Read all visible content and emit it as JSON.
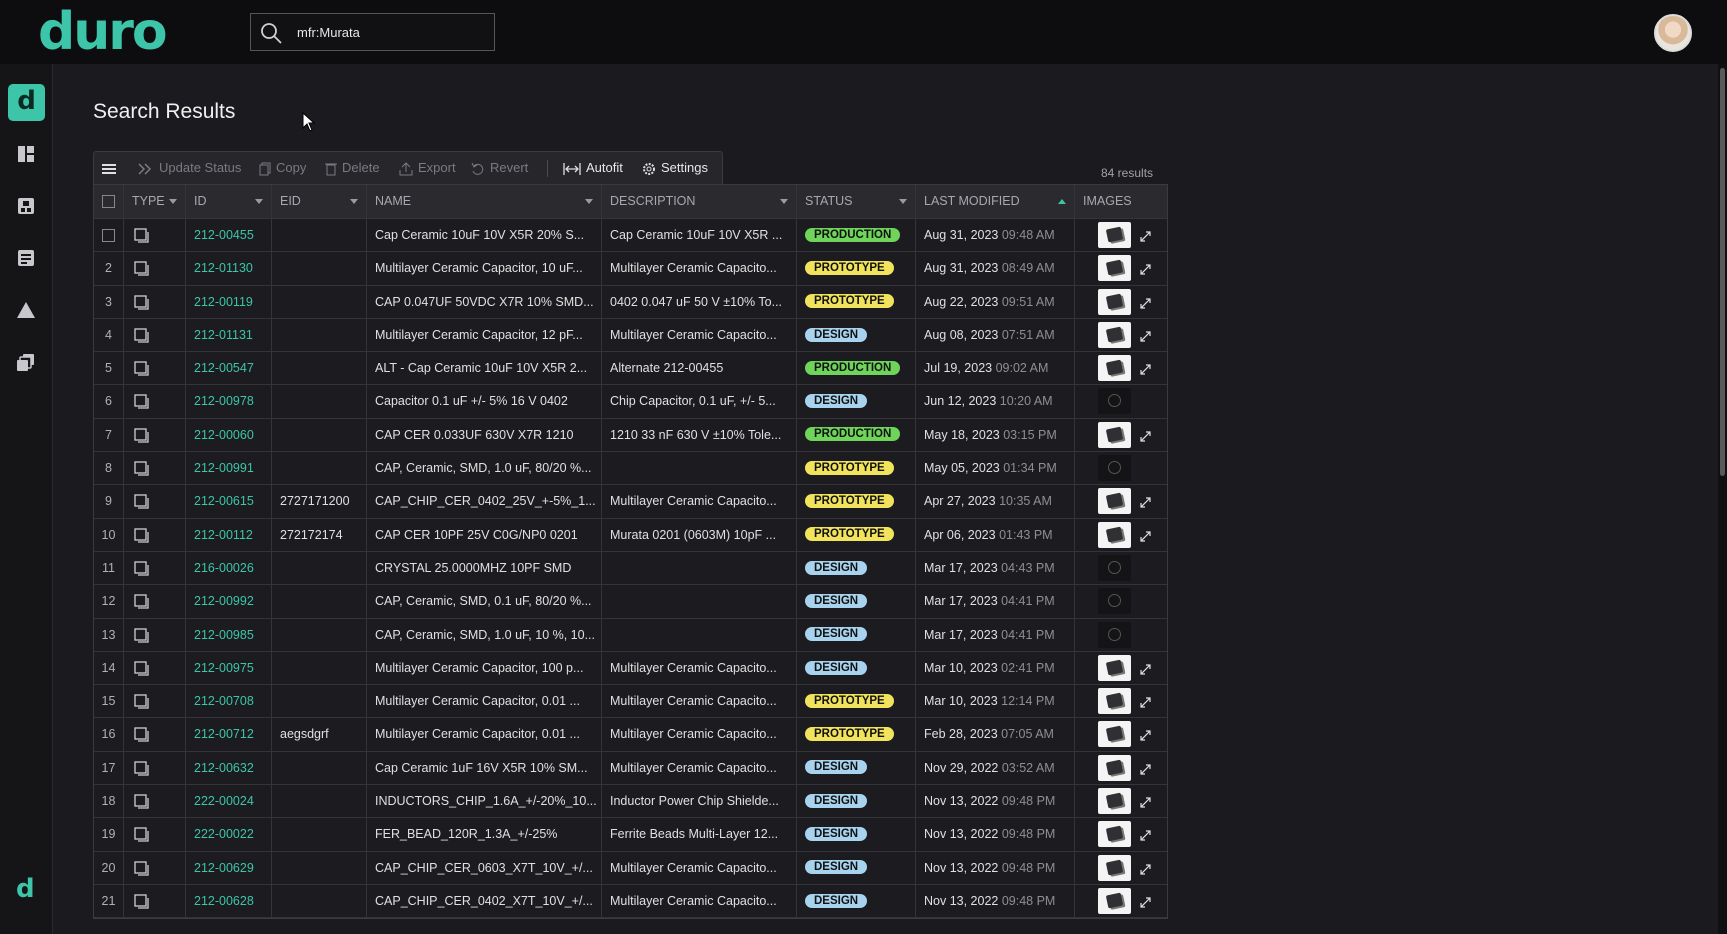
{
  "app": {
    "logo": "duro",
    "sidebar_logo": "d",
    "sidebar_footer_logo": "d"
  },
  "search": {
    "value": "mfr:Murata"
  },
  "page": {
    "title": "Search Results",
    "results_count": "84 results"
  },
  "toolbar": {
    "update_status": "Update Status",
    "copy": "Copy",
    "delete": "Delete",
    "export": "Export",
    "revert": "Revert",
    "autofit": "Autofit",
    "settings": "Settings"
  },
  "columns": {
    "type": "TYPE",
    "id": "ID",
    "eid": "EID",
    "name": "NAME",
    "description": "DESCRIPTION",
    "status": "STATUS",
    "last_modified": "LAST MODIFIED",
    "images": "IMAGES"
  },
  "colors": {
    "accent": "#3cc5a8",
    "production": "#6ed45a",
    "prototype": "#f1e45c",
    "design": "#a8d3ee"
  },
  "rows": [
    {
      "n": "",
      "id": "212-00455",
      "eid": "",
      "name": "Cap Ceramic 10uF 10V X5R 20% S...",
      "desc": "Cap Ceramic 10uF 10V X5R ...",
      "status": "PRODUCTION",
      "date": "Aug 31, 2023",
      "time": "09:48 AM",
      "img": true
    },
    {
      "n": "2",
      "id": "212-01130",
      "eid": "",
      "name": "Multilayer Ceramic Capacitor, 10 uF...",
      "desc": "Multilayer Ceramic Capacito...",
      "status": "PROTOTYPE",
      "date": "Aug 31, 2023",
      "time": "08:49 AM",
      "img": true
    },
    {
      "n": "3",
      "id": "212-00119",
      "eid": "",
      "name": "CAP 0.047UF 50VDC X7R 10% SMD...",
      "desc": "0402 0.047 uF 50 V ±10% To...",
      "status": "PROTOTYPE",
      "date": "Aug 22, 2023",
      "time": "09:51 AM",
      "img": true
    },
    {
      "n": "4",
      "id": "212-01131",
      "eid": "",
      "name": "Multilayer Ceramic Capacitor, 12 pF...",
      "desc": "Multilayer Ceramic Capacito...",
      "status": "DESIGN",
      "date": "Aug 08, 2023",
      "time": "07:51 AM",
      "img": true
    },
    {
      "n": "5",
      "id": "212-00547",
      "eid": "",
      "name": "ALT - Cap Ceramic 10uF 10V X5R 2...",
      "desc": "Alternate 212-00455",
      "status": "PRODUCTION",
      "date": "Jul 19, 2023",
      "time": "09:02 AM",
      "img": true
    },
    {
      "n": "6",
      "id": "212-00978",
      "eid": "",
      "name": "Capacitor 0.1 uF +/- 5% 16 V 0402",
      "desc": "Chip Capacitor, 0.1 uF, +/- 5...",
      "status": "DESIGN",
      "date": "Jun 12, 2023",
      "time": "10:20 AM",
      "img": false
    },
    {
      "n": "7",
      "id": "212-00060",
      "eid": "",
      "name": "CAP CER 0.033UF 630V X7R 1210",
      "desc": "1210 33 nF 630 V ±10% Tole...",
      "status": "PRODUCTION",
      "date": "May 18, 2023",
      "time": "03:15 PM",
      "img": true
    },
    {
      "n": "8",
      "id": "212-00991",
      "eid": "",
      "name": "CAP, Ceramic, SMD, 1.0 uF, 80/20 %...",
      "desc": "",
      "status": "PROTOTYPE",
      "date": "May 05, 2023",
      "time": "01:34 PM",
      "img": false
    },
    {
      "n": "9",
      "id": "212-00615",
      "eid": "2727171200",
      "name": "CAP_CHIP_CER_0402_25V_+-5%_1...",
      "desc": "Multilayer Ceramic Capacito...",
      "status": "PROTOTYPE",
      "date": "Apr 27, 2023",
      "time": "10:35 AM",
      "img": true
    },
    {
      "n": "10",
      "id": "212-00112",
      "eid": "272172174",
      "name": "CAP CER 10PF 25V C0G/NP0 0201",
      "desc": "Murata 0201 (0603M) 10pF ...",
      "status": "PROTOTYPE",
      "date": "Apr 06, 2023",
      "time": "01:43 PM",
      "img": true
    },
    {
      "n": "11",
      "id": "216-00026",
      "eid": "",
      "name": "CRYSTAL 25.0000MHZ 10PF SMD",
      "desc": "",
      "status": "DESIGN",
      "date": "Mar 17, 2023",
      "time": "04:43 PM",
      "img": false
    },
    {
      "n": "12",
      "id": "212-00992",
      "eid": "",
      "name": "CAP, Ceramic, SMD, 0.1 uF, 80/20 %...",
      "desc": "",
      "status": "DESIGN",
      "date": "Mar 17, 2023",
      "time": "04:41 PM",
      "img": false
    },
    {
      "n": "13",
      "id": "212-00985",
      "eid": "",
      "name": "CAP, Ceramic, SMD, 1.0 uF, 10 %, 10...",
      "desc": "",
      "status": "DESIGN",
      "date": "Mar 17, 2023",
      "time": "04:41 PM",
      "img": false
    },
    {
      "n": "14",
      "id": "212-00975",
      "eid": "",
      "name": "Multilayer Ceramic Capacitor, 100 p...",
      "desc": "Multilayer Ceramic Capacito...",
      "status": "DESIGN",
      "date": "Mar 10, 2023",
      "time": "02:41 PM",
      "img": true
    },
    {
      "n": "15",
      "id": "212-00708",
      "eid": "",
      "name": "Multilayer Ceramic Capacitor, 0.01 ...",
      "desc": "Multilayer Ceramic Capacito...",
      "status": "PROTOTYPE",
      "date": "Mar 10, 2023",
      "time": "12:14 PM",
      "img": true
    },
    {
      "n": "16",
      "id": "212-00712",
      "eid": "aegsdgrf",
      "name": "Multilayer Ceramic Capacitor, 0.01 ...",
      "desc": "Multilayer Ceramic Capacito...",
      "status": "PROTOTYPE",
      "date": "Feb 28, 2023",
      "time": "07:05 AM",
      "img": true
    },
    {
      "n": "17",
      "id": "212-00632",
      "eid": "",
      "name": "Cap Ceramic 1uF 16V X5R 10% SM...",
      "desc": "Multilayer Ceramic Capacito...",
      "status": "DESIGN",
      "date": "Nov 29, 2022",
      "time": "03:52 AM",
      "img": true
    },
    {
      "n": "18",
      "id": "222-00024",
      "eid": "",
      "name": "INDUCTORS_CHIP_1.6A_+/-20%_10...",
      "desc": "Inductor Power Chip Shielde...",
      "status": "DESIGN",
      "date": "Nov 13, 2022",
      "time": "09:48 PM",
      "img": true
    },
    {
      "n": "19",
      "id": "222-00022",
      "eid": "",
      "name": "FER_BEAD_120R_1.3A_+/-25%",
      "desc": "Ferrite Beads Multi-Layer 12...",
      "status": "DESIGN",
      "date": "Nov 13, 2022",
      "time": "09:48 PM",
      "img": true
    },
    {
      "n": "20",
      "id": "212-00629",
      "eid": "",
      "name": "CAP_CHIP_CER_0603_X7T_10V_+/...",
      "desc": "Multilayer Ceramic Capacito...",
      "status": "DESIGN",
      "date": "Nov 13, 2022",
      "time": "09:48 PM",
      "img": true
    },
    {
      "n": "21",
      "id": "212-00628",
      "eid": "",
      "name": "CAP_CHIP_CER_0402_X7T_10V_+/...",
      "desc": "Multilayer Ceramic Capacito...",
      "status": "DESIGN",
      "date": "Nov 13, 2022",
      "time": "09:48 PM",
      "img": true
    }
  ]
}
